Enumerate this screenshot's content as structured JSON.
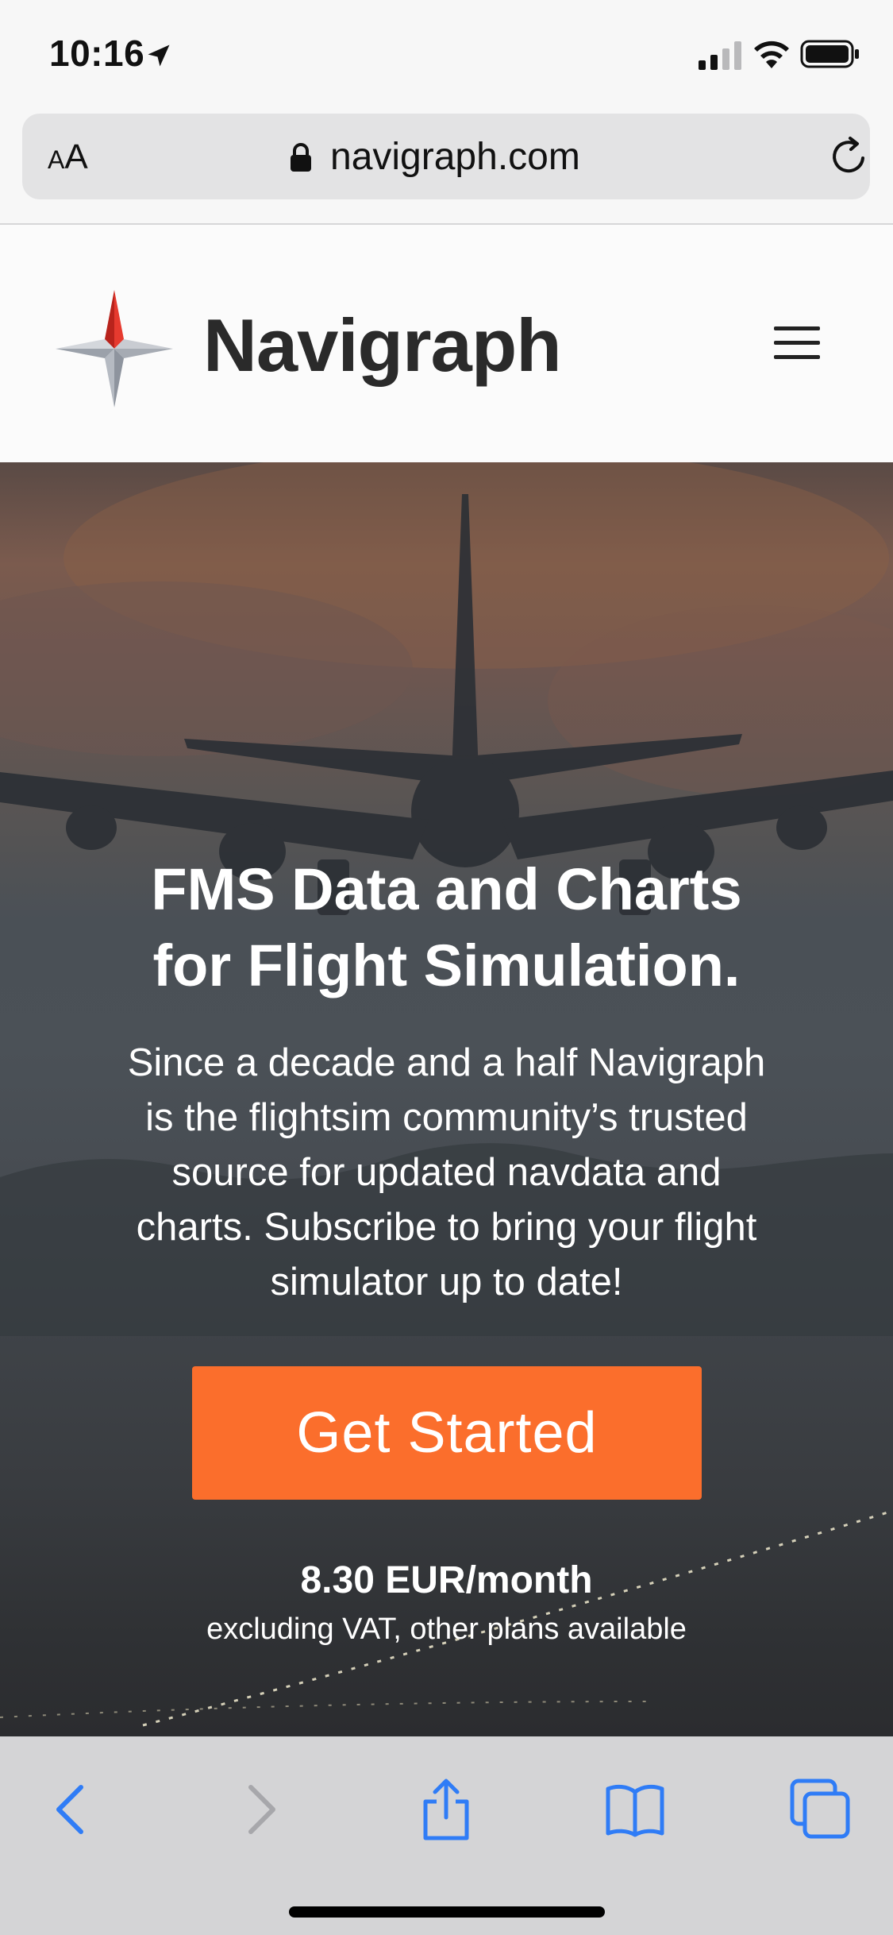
{
  "status_bar": {
    "time": "10:16",
    "icons": [
      "location-arrow-icon",
      "cellular-signal-icon",
      "wifi-icon",
      "battery-icon"
    ]
  },
  "address_bar": {
    "text_size_label_small": "A",
    "text_size_label_large": "A",
    "url": "navigraph.com",
    "icons": [
      "lock-icon",
      "reload-icon"
    ]
  },
  "site_header": {
    "brand": "Navigraph",
    "icons": [
      "navigraph-logo",
      "hamburger-menu-icon"
    ]
  },
  "hero": {
    "title_line1": "FMS Data and Charts",
    "title_line2": "for Flight Simulation.",
    "body_line1": "Since a decade and a half Navigraph",
    "body_line2": "is the flightsim community’s trusted",
    "body_line3": "source for updated navdata and",
    "body_line4": "charts. Subscribe to bring your flight",
    "body_line5": "simulator up to date!",
    "cta_label": "Get Started",
    "price": "8.30 EUR/month",
    "price_note": "excluding VAT, other plans available"
  },
  "toolbar": {
    "icons": [
      "back-icon",
      "forward-icon",
      "share-icon",
      "bookmarks-icon",
      "tabs-icon"
    ]
  },
  "colors": {
    "accent": "#fb6e2c",
    "safari_blue": "#2f7cf6",
    "logo_red": "#d8322a",
    "logo_gray": "#8e949e"
  }
}
